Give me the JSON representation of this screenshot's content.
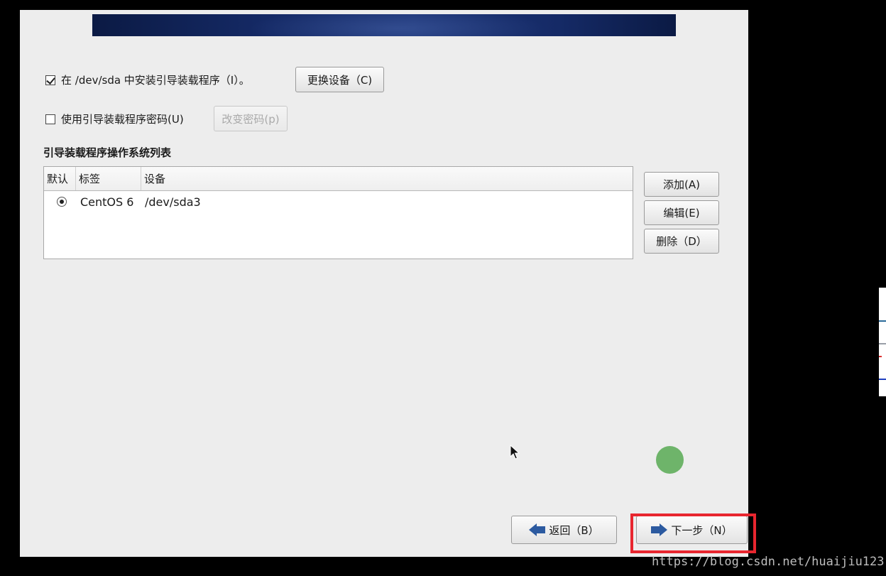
{
  "bootloader": {
    "install_label": "在 /dev/sda 中安装引导装载程序（I）。",
    "install_checked": true,
    "change_device_button": "更换设备（C)",
    "password_label": "使用引导装载程序密码(U)",
    "password_checked": false,
    "change_password_button": "改变密码(p)"
  },
  "os_list": {
    "title": "引导装载程序操作系统列表",
    "columns": [
      "默认",
      "标签",
      "设备"
    ],
    "rows": [
      {
        "default": true,
        "label": "CentOS 6",
        "device": "/dev/sda3"
      }
    ],
    "add_button": "添加(A)",
    "edit_button": "编辑(E)",
    "delete_button": "删除（D）"
  },
  "navigation": {
    "back_button": "返回（B）",
    "next_button": "下一步（N）"
  },
  "watermark": "https://blog.csdn.net/huaijiu123",
  "colors": {
    "panel": "#ededed",
    "banner": "#152a66",
    "highlight": "#e8262f",
    "arrow": "#2c5aa0",
    "green_dot": "#6eb46a"
  },
  "icons": {
    "back": "arrow-left-icon",
    "next": "arrow-right-icon"
  }
}
